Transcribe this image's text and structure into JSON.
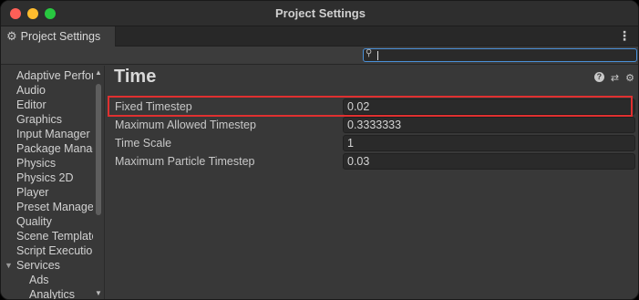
{
  "window": {
    "title": "Project Settings"
  },
  "tab": {
    "label": "Project Settings",
    "icon": "gear-icon"
  },
  "search": {
    "value": "",
    "placeholder": ""
  },
  "sidebar": {
    "items": [
      {
        "label": "Adaptive Performance",
        "level": 0
      },
      {
        "label": "Audio",
        "level": 0
      },
      {
        "label": "Editor",
        "level": 0
      },
      {
        "label": "Graphics",
        "level": 0
      },
      {
        "label": "Input Manager",
        "level": 0
      },
      {
        "label": "Package Manager",
        "level": 0
      },
      {
        "label": "Physics",
        "level": 0
      },
      {
        "label": "Physics 2D",
        "level": 0
      },
      {
        "label": "Player",
        "level": 0
      },
      {
        "label": "Preset Manager",
        "level": 0
      },
      {
        "label": "Quality",
        "level": 0
      },
      {
        "label": "Scene Template",
        "level": 0
      },
      {
        "label": "Script Execution Order",
        "level": 0
      },
      {
        "label": "Services",
        "level": 0,
        "expanded": true
      },
      {
        "label": "Ads",
        "level": 1
      },
      {
        "label": "Analytics",
        "level": 1
      }
    ]
  },
  "main": {
    "title": "Time",
    "header_icons": [
      "help-icon",
      "sliders-icon",
      "gear-icon"
    ],
    "rows": [
      {
        "label": "Fixed Timestep",
        "value": "0.02",
        "highlighted": true
      },
      {
        "label": "Maximum Allowed Timestep",
        "value": "0.3333333"
      },
      {
        "label": "Time Scale",
        "value": "1"
      },
      {
        "label": "Maximum Particle Timestep",
        "value": "0.03"
      }
    ]
  },
  "colors": {
    "highlight": "#e03030",
    "search_focus": "#4a90d9"
  }
}
